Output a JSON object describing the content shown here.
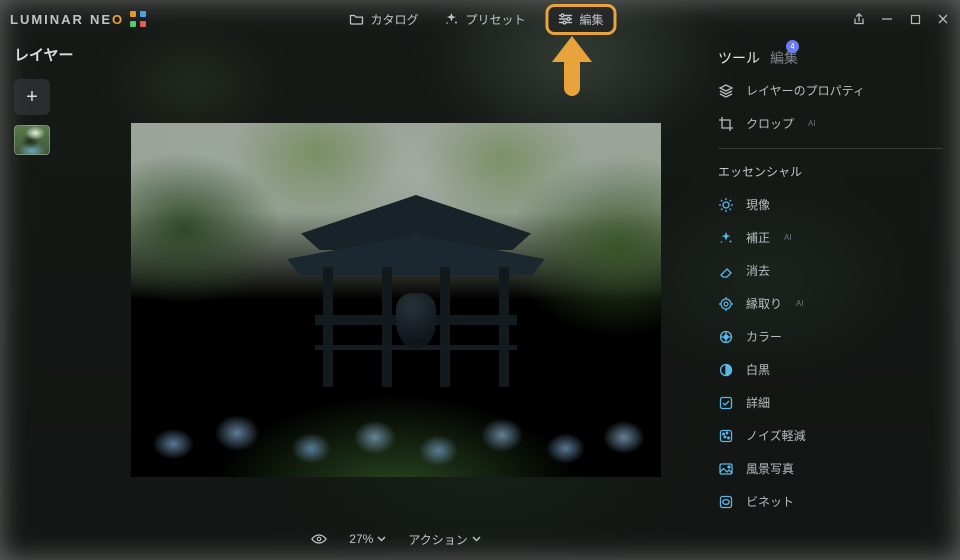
{
  "app": {
    "name_part1": "LUMINAR",
    "name_part2": "NE",
    "name_accent": "O"
  },
  "topnav": {
    "catalog": "カタログ",
    "presets": "プリセット",
    "edit": "編集"
  },
  "left": {
    "title": "レイヤー",
    "add_label": "+"
  },
  "right": {
    "tools_label": "ツール",
    "edits_label": "編集",
    "badge": "4",
    "layer_properties": "レイヤーのプロパティ",
    "crop": "クロップ",
    "crop_ai": "AI",
    "section_essentials": "エッセンシャル",
    "tools": [
      {
        "label": "現像",
        "ai": ""
      },
      {
        "label": "補正",
        "ai": "AI"
      },
      {
        "label": "消去",
        "ai": ""
      },
      {
        "label": "縁取り",
        "ai": "AI"
      },
      {
        "label": "カラー",
        "ai": ""
      },
      {
        "label": "白黒",
        "ai": ""
      },
      {
        "label": "詳細",
        "ai": ""
      },
      {
        "label": "ノイズ軽減",
        "ai": ""
      },
      {
        "label": "風景写真",
        "ai": ""
      },
      {
        "label": "ビネット",
        "ai": ""
      }
    ]
  },
  "bottom": {
    "zoom": "27%",
    "action": "アクション"
  },
  "colors": {
    "accent": "#E9A33C"
  }
}
